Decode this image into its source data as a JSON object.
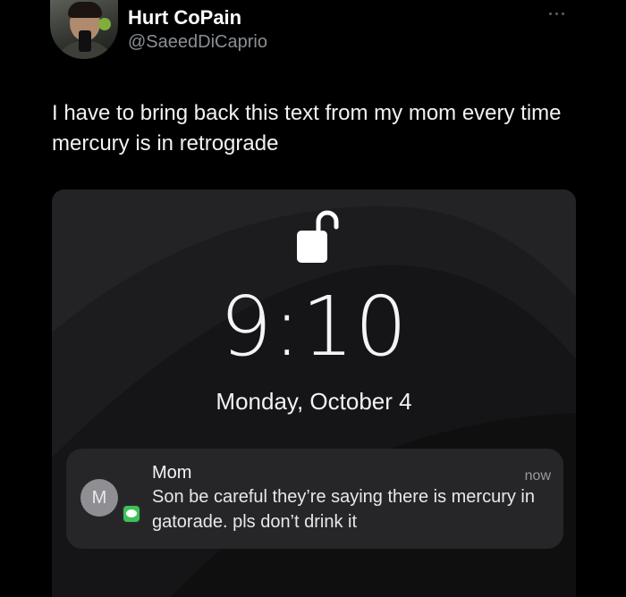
{
  "tweet": {
    "display_name": "Hurt CoPain",
    "handle": "@SaeedDiCaprio",
    "text": "I have to bring back this text from my mom every time mercury is in retrograde"
  },
  "lockscreen": {
    "time": "9:10",
    "date": "Monday, October 4",
    "notification": {
      "avatar_initial": "M",
      "sender": "Mom",
      "timestamp": "now",
      "message": "Son be careful they’re saying there is mercury in gatorade. pls don’t drink it",
      "app_icon": "messages-icon"
    }
  },
  "colors": {
    "background": "#000000",
    "handle_gray": "#8b8f93",
    "messages_green": "#3cc15a"
  }
}
